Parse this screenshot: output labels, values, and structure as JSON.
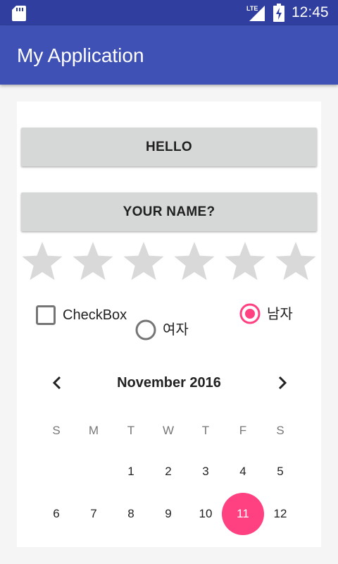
{
  "status_bar": {
    "time": "12:45",
    "network_label": "LTE",
    "icons": [
      "sd-card-icon",
      "signal-icon",
      "battery-charging-icon"
    ]
  },
  "app_bar": {
    "title": "My Application"
  },
  "content": {
    "hello_button": "HELLO",
    "name_button": "YOUR NAME?",
    "rating": {
      "value": 0,
      "max": 6
    },
    "checkbox": {
      "label": "CheckBox",
      "checked": false
    },
    "radio_female": {
      "label": "여자",
      "checked": false
    },
    "radio_male": {
      "label": "남자",
      "checked": true
    },
    "calendar": {
      "month_label": "November 2016",
      "weekdays": [
        "S",
        "M",
        "T",
        "W",
        "T",
        "F",
        "S"
      ],
      "week1": [
        "1",
        "2",
        "3",
        "4",
        "5"
      ],
      "week2": [
        "6",
        "7",
        "8",
        "9",
        "10",
        "11",
        "12"
      ],
      "selected_day": "11"
    }
  },
  "colors": {
    "status_bar": "#303f9f",
    "app_bar": "#3f51b5",
    "accent": "#ff4081",
    "button": "#d6d7d7",
    "star_empty": "#d9d9d9"
  }
}
